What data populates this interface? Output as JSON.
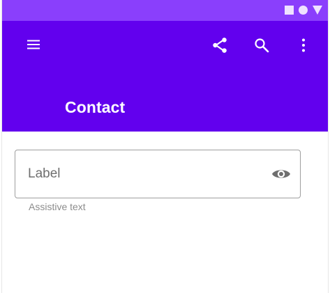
{
  "status_bar": {
    "color": "#8a3ffc",
    "icons": [
      "square-icon",
      "circle-icon",
      "triangle-icon"
    ]
  },
  "app_bar": {
    "color": "#6200ee",
    "title": "Contact",
    "actions": [
      "menu-icon",
      "share-icon",
      "search-icon",
      "more-vert-icon"
    ]
  },
  "text_field": {
    "placeholder": "Label",
    "value": "",
    "trailing_icon": "eye-icon",
    "assistive_text": "Assistive text"
  }
}
